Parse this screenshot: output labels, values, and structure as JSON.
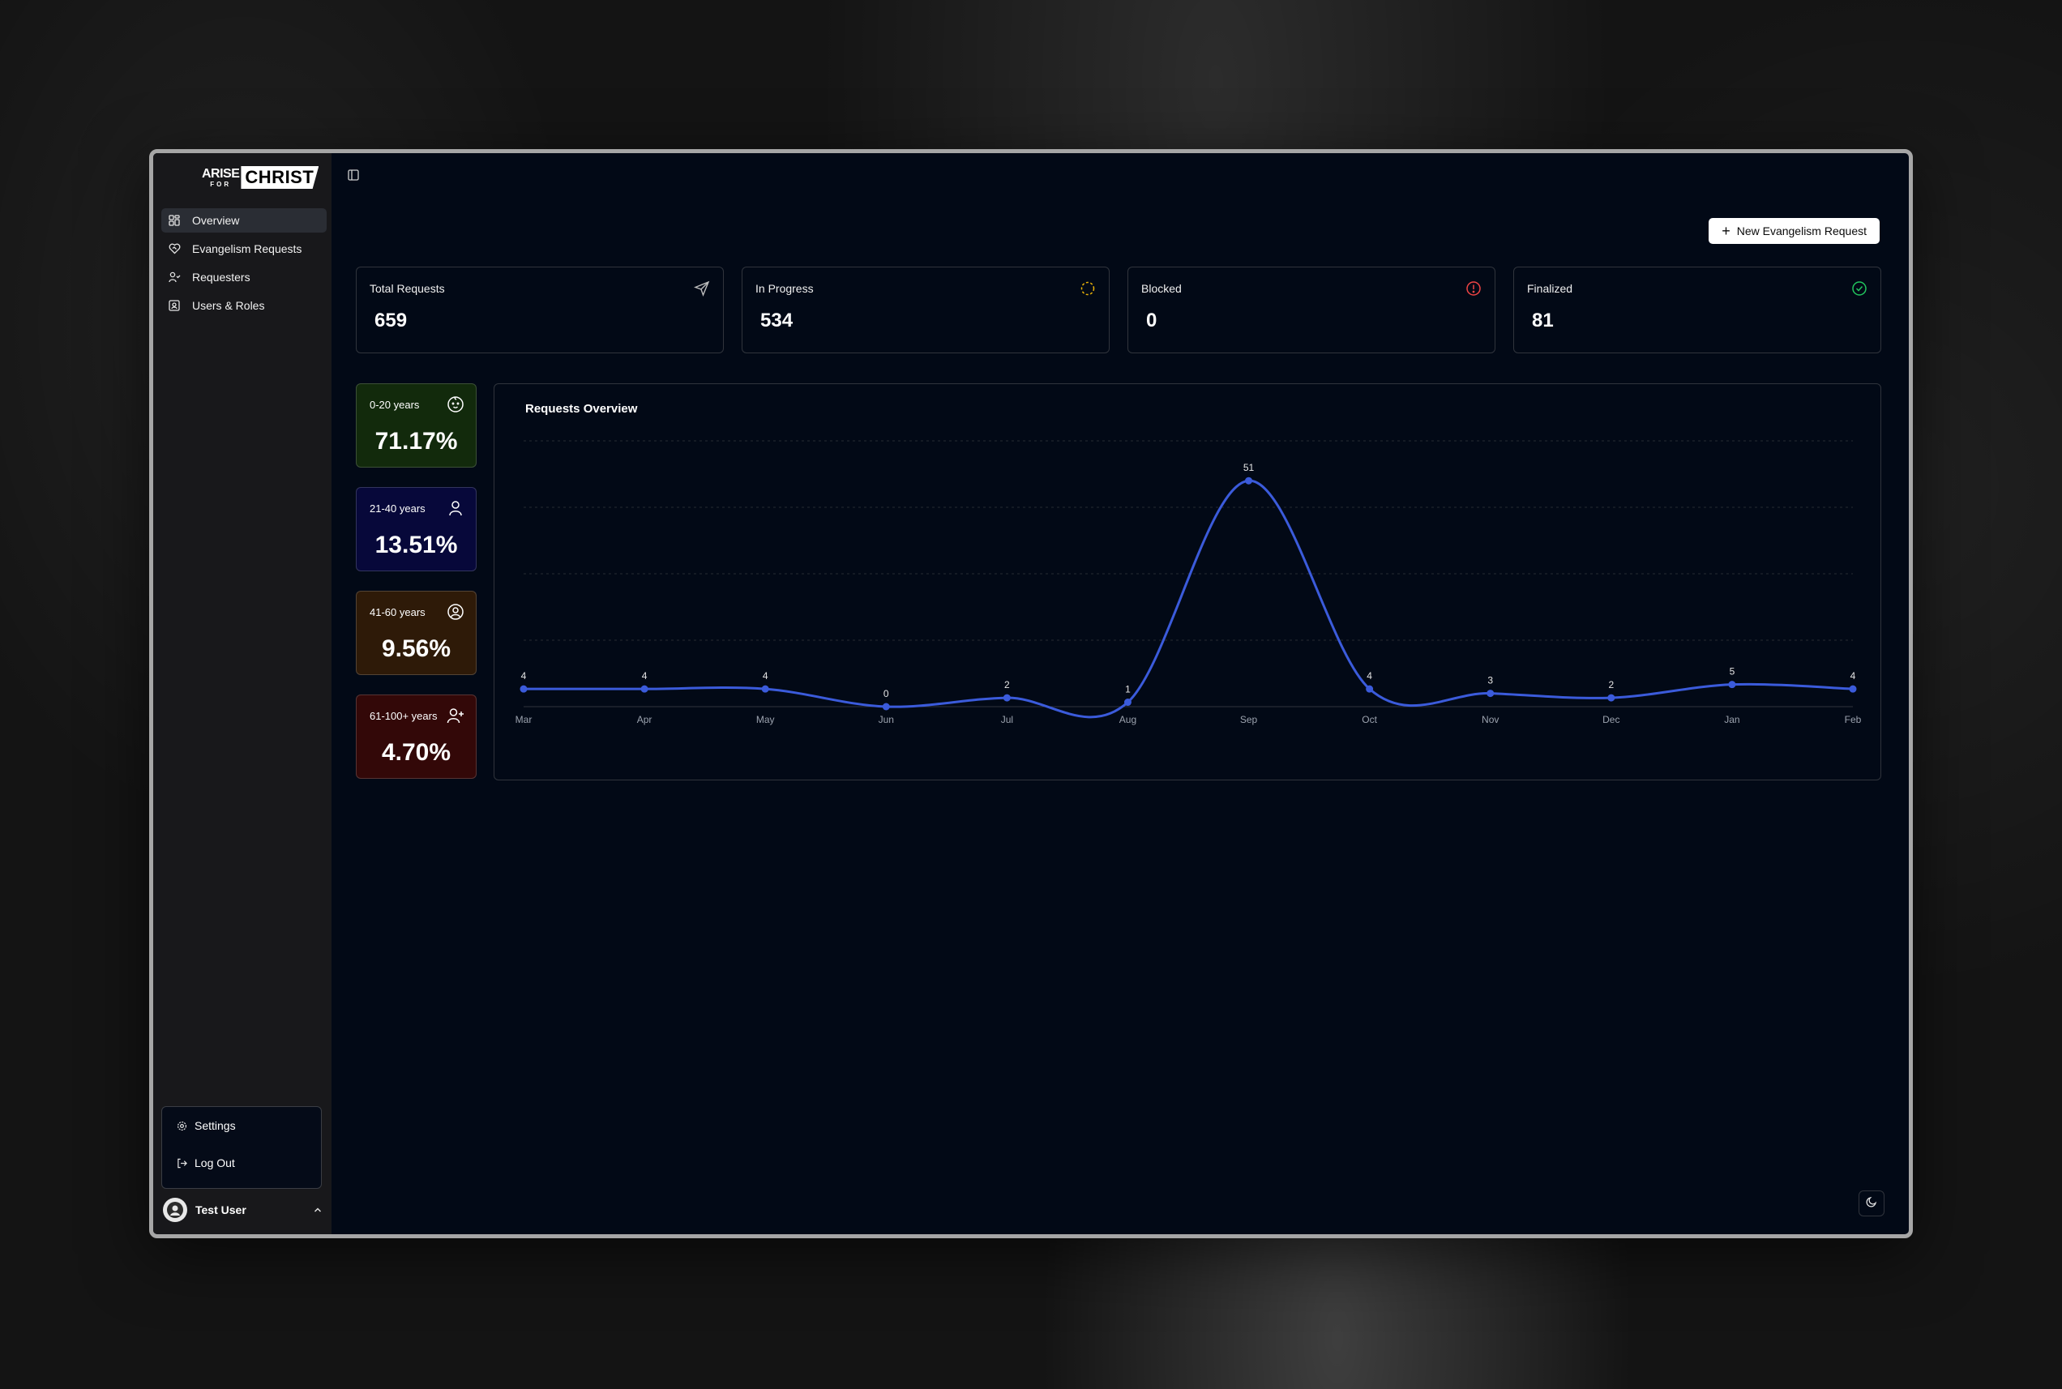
{
  "sidebar": {
    "logo": {
      "arise": "ARISE",
      "for": "FOR",
      "christ": "CHRIST"
    },
    "items": [
      {
        "label": "Overview",
        "icon": "grid-icon"
      },
      {
        "label": "Evangelism Requests",
        "icon": "heart-handshake-icon"
      },
      {
        "label": "Requesters",
        "icon": "user-check-icon"
      },
      {
        "label": "Users & Roles",
        "icon": "contact-icon"
      }
    ],
    "menu": {
      "settings": "Settings",
      "logout": "Log Out"
    },
    "user": {
      "name": "Test User"
    }
  },
  "header": {
    "new_button": "New Evangelism Request"
  },
  "stats": [
    {
      "label": "Total Requests",
      "value": "659",
      "icon": "send-icon"
    },
    {
      "label": "In Progress",
      "value": "534",
      "icon": "loader-icon",
      "color": "#eab308"
    },
    {
      "label": "Blocked",
      "value": "0",
      "icon": "alert-circle-icon",
      "color": "#ef4444"
    },
    {
      "label": "Finalized",
      "value": "81",
      "icon": "check-circle-icon",
      "color": "#22c55e"
    }
  ],
  "age_groups": [
    {
      "label": "0-20 years",
      "pct": "71.17%",
      "icon": "baby-icon",
      "bg": "#122a0c"
    },
    {
      "label": "21-40 years",
      "pct": "13.51%",
      "icon": "user-icon",
      "bg": "#07083a"
    },
    {
      "label": "41-60 years",
      "pct": "9.56%",
      "icon": "user-circle-icon",
      "bg": "#2e1a08"
    },
    {
      "label": "61-100+ years",
      "pct": "4.70%",
      "icon": "user-plus-icon",
      "bg": "#330808"
    }
  ],
  "chart_data": {
    "type": "line",
    "title": "Requests Overview",
    "categories": [
      "Mar",
      "Apr",
      "May",
      "Jun",
      "Jul",
      "Aug",
      "Sep",
      "Oct",
      "Nov",
      "Dec",
      "Jan",
      "Feb"
    ],
    "values": [
      4,
      4,
      4,
      0,
      2,
      1,
      51,
      4,
      3,
      2,
      5,
      4
    ],
    "ylim": [
      0,
      60
    ],
    "grid": true,
    "color": "#3b5bdb"
  }
}
